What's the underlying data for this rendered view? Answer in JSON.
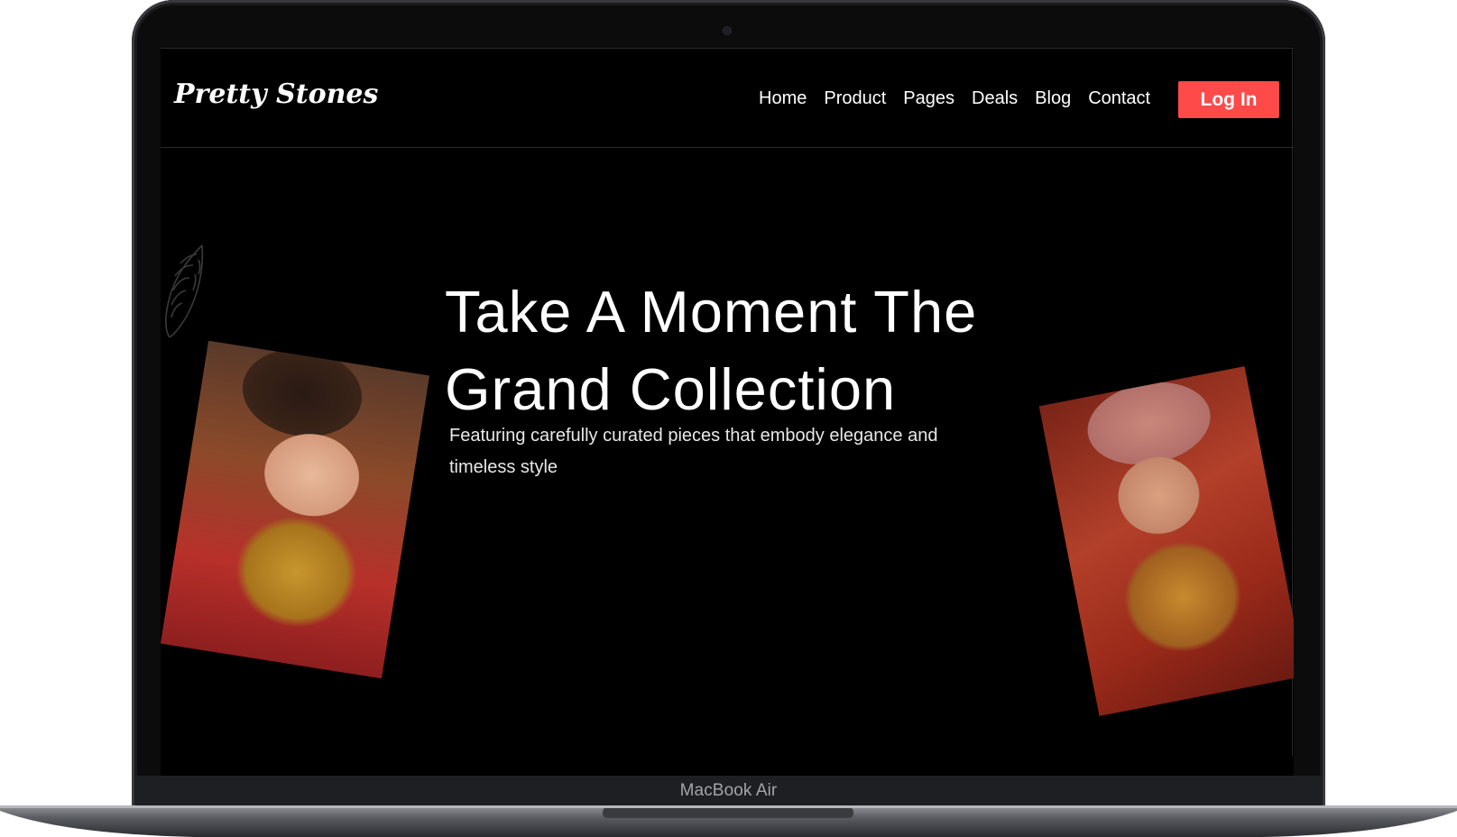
{
  "device": {
    "model_label": "MacBook Air"
  },
  "site": {
    "logo": "Pretty Stones",
    "nav": {
      "links": [
        "Home",
        "Product",
        "Pages",
        "Deals",
        "Blog",
        "Contact"
      ],
      "login_label": "Log In"
    },
    "hero": {
      "headline_line1": "Take A Moment The",
      "headline_line2": "Grand Collection",
      "subtext": "Featuring carefully curated pieces that embody elegance and timeless style"
    },
    "images": {
      "left_photo": "bride-portrait-photo",
      "right_photo": "bride-veil-portrait-photo",
      "decor": "leaf-line-icon"
    }
  },
  "colors": {
    "background": "#000000",
    "text": "#ffffff",
    "accent": "#ff4a4a",
    "laptop_frame": "#0c0c0d",
    "laptop_base": "#4a4b50"
  }
}
